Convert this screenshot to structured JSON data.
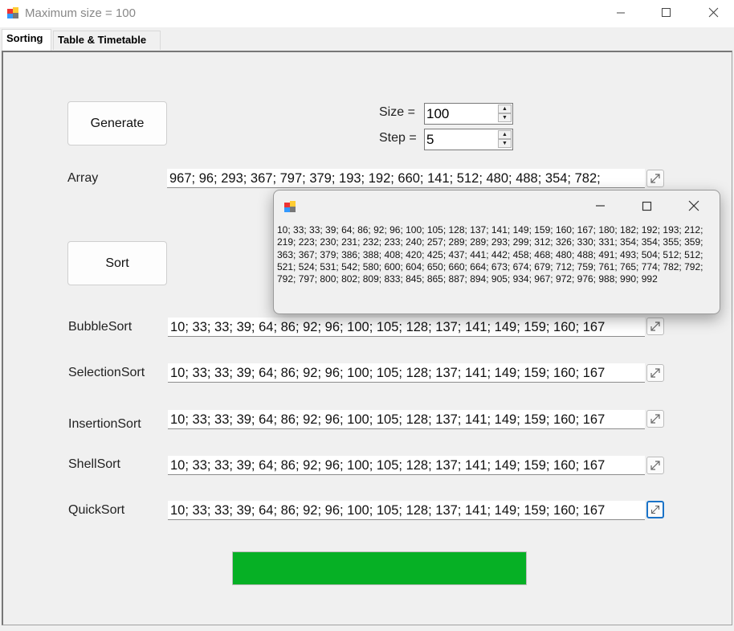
{
  "window": {
    "title": "Maximum size = 100"
  },
  "tabs": [
    {
      "label": "Sorting"
    },
    {
      "label": "Table & Timetable"
    }
  ],
  "controls": {
    "generate_label": "Generate",
    "sort_label": "Sort",
    "size_label": "Size =",
    "size_value": "100",
    "step_label": "Step =",
    "step_value": "5",
    "array_label": "Array",
    "array_value": "967; 96; 293; 367; 797; 379; 193; 192; 660; 141; 512; 480; 488; 354; 782;"
  },
  "sorts": [
    {
      "label": "BubbleSort",
      "value": "10; 33; 33; 39; 64; 86; 92; 96; 100; 105; 128; 137; 141; 149; 159; 160; 167"
    },
    {
      "label": "SelectionSort",
      "value": "10; 33; 33; 39; 64; 86; 92; 96; 100; 105; 128; 137; 141; 149; 159; 160; 167"
    },
    {
      "label": "InsertionSort",
      "value": "10; 33; 33; 39; 64; 86; 92; 96; 100; 105; 128; 137; 141; 149; 159; 160; 167"
    },
    {
      "label": "ShellSort",
      "value": "10; 33; 33; 39; 64; 86; 92; 96; 100; 105; 128; 137; 141; 149; 159; 160; 167"
    },
    {
      "label": "QuickSort",
      "value": "10; 33; 33; 39; 64; 86; 92; 96; 100; 105; 128; 137; 141; 149; 159; 160; 167"
    }
  ],
  "popup": {
    "text": "10; 33; 33; 39; 64; 86; 92; 96; 100; 105; 128; 137; 141; 149; 159; 160; 167; 180; 182; 192; 193; 212; 219; 223; 230; 231; 232; 233; 240; 257; 289; 289; 293; 299; 312; 326; 330; 331; 354; 354; 355; 359; 363; 367; 379; 386; 388; 408; 420; 425; 437; 441; 442; 458; 468; 480; 488; 491; 493; 504; 512; 512; 521; 524; 531; 542; 580; 600; 604; 650; 660; 664; 673; 674; 679; 712; 759; 761; 765; 774; 782; 792; 792; 797; 800; 802; 809; 833; 845; 865; 887; 894; 905; 934; 967; 972; 976; 988; 990; 992"
  },
  "progress": {
    "fraction": 1.0
  },
  "colors": {
    "progress_fill": "#06b025",
    "focus_border": "#1a73c8"
  }
}
